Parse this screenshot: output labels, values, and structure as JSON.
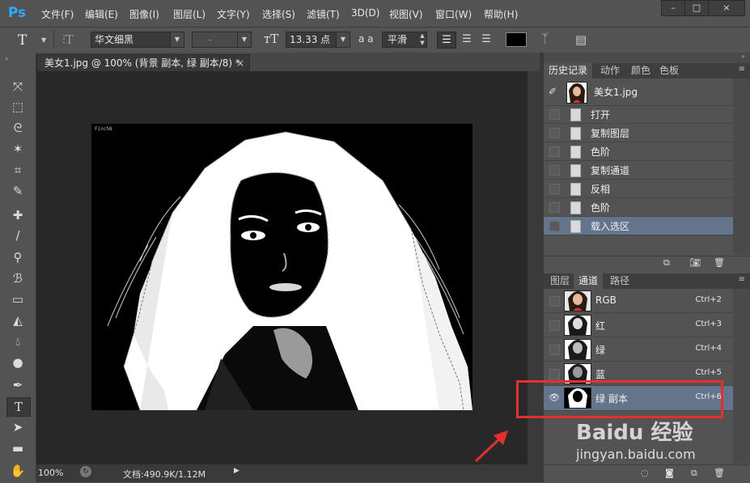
{
  "app": {
    "logo": "Ps"
  },
  "menu": [
    "文件(F)",
    "编辑(E)",
    "图像(I)",
    "图层(L)",
    "文字(Y)",
    "选择(S)",
    "滤镜(T)",
    "3D(D)",
    "视图(V)",
    "窗口(W)",
    "帮助(H)"
  ],
  "window_buttons": {
    "minimize": "–",
    "maximize": "□",
    "close": "×"
  },
  "options": {
    "tool_glyph": "T",
    "font_family": "华文细黑",
    "font_style": "-",
    "font_size": "13.33 点",
    "aa_label": "a a",
    "antialias": "平滑",
    "color_swatch": "#000000"
  },
  "document": {
    "tab_title": "美女1.jpg @ 100% (背景 副本, 绿 副本/8) *",
    "close_glyph": "×",
    "watermark": "Finch8",
    "status_zoom": "100%",
    "status_doc": "文档:490.9K/1.12M"
  },
  "history_panel": {
    "tabs": [
      "历史记录",
      "动作",
      "颜色",
      "色板"
    ],
    "snapshot_label": "美女1.jpg",
    "items": [
      "打开",
      "复制图层",
      "色阶",
      "复制通道",
      "反相",
      "色阶",
      "载入选区"
    ],
    "selected_index": 6
  },
  "channels_panel": {
    "tabs": [
      "图层",
      "通道",
      "路径"
    ],
    "rows": [
      {
        "name": "RGB",
        "shortcut": "Ctrl+2"
      },
      {
        "name": "红",
        "shortcut": "Ctrl+3"
      },
      {
        "name": "绿",
        "shortcut": "Ctrl+4"
      },
      {
        "name": "蓝",
        "shortcut": "Ctrl+5"
      },
      {
        "name": "绿 副本",
        "shortcut": "Ctrl+6"
      }
    ],
    "selected_index": 4
  },
  "annotation": {
    "highlight_color": "#e53030",
    "arrow_color": "#e53030"
  },
  "watermark_site": {
    "brand": "Baidu 经验",
    "url": "jingyan.baidu.com"
  }
}
